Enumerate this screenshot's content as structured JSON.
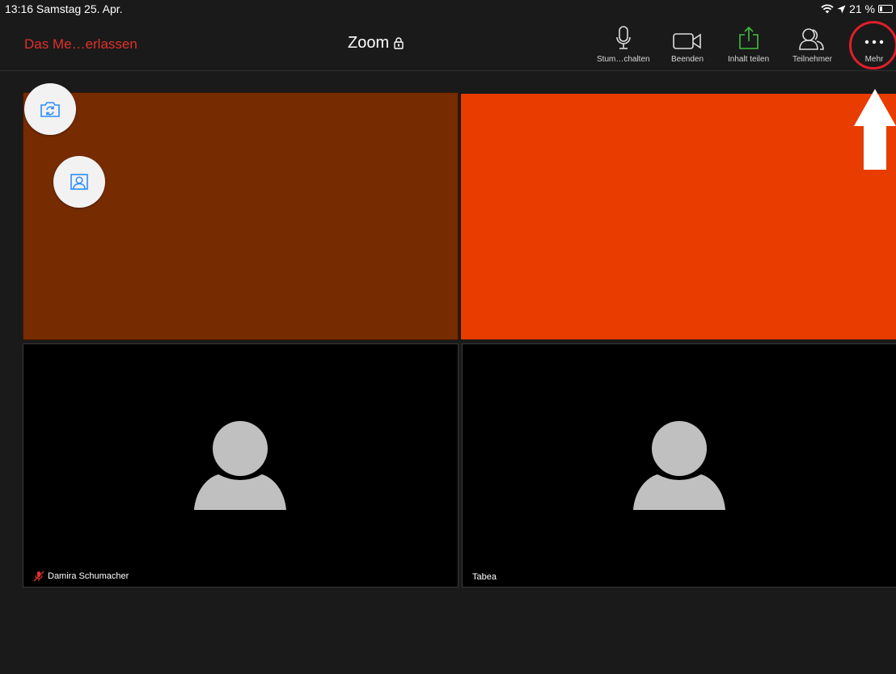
{
  "status_bar": {
    "time_date": "13:16  Samstag 25. Apr.",
    "battery_text": "21 %",
    "battery_level": 0.21
  },
  "toolbar": {
    "leave_label": "Das Me…erlassen",
    "title": "Zoom",
    "mute_label": "Stum…chalten",
    "stop_video_label": "Beenden",
    "share_label": "Inhalt teilen",
    "participants_label": "Teilnehmer",
    "more_label": "Mehr"
  },
  "participants": [
    {
      "name": "Damira Schumacher",
      "muted": true
    },
    {
      "name": "Tabea",
      "muted": false
    }
  ],
  "colors": {
    "leave": "#e0312b",
    "share_icon": "#3fbf3f",
    "highlight_ring": "#e01f2a",
    "tile_1": "#772b00",
    "tile_2": "#e83c00",
    "icon_blue": "#2d8cff"
  },
  "icons": {
    "camera_switch": "camera-switch-icon",
    "virtual_background": "virtual-background-icon",
    "lock": "lock-icon"
  }
}
